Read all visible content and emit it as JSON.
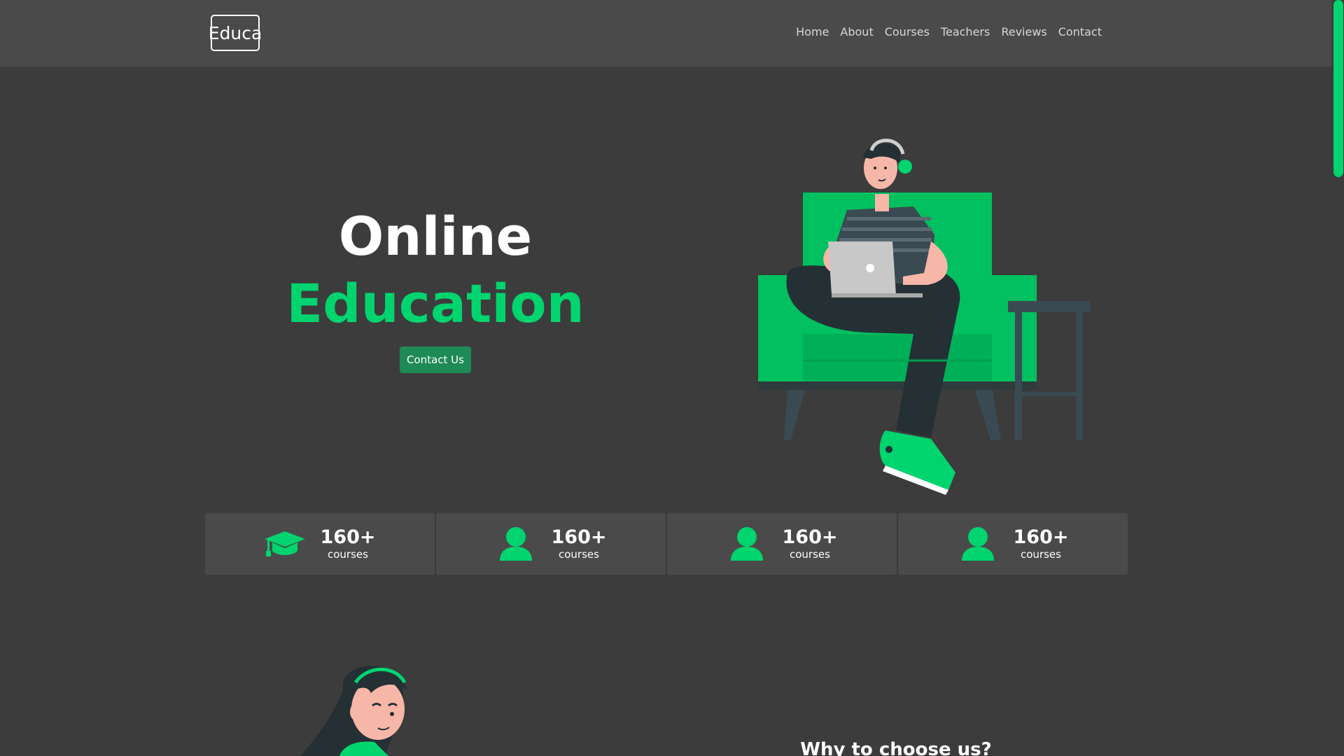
{
  "header": {
    "logo": "Educa",
    "nav": [
      "Home",
      "About",
      "Courses",
      "Teachers",
      "Reviews",
      "Contact"
    ]
  },
  "hero": {
    "line1": "Online",
    "line2": "Education",
    "cta_label": "Contact Us"
  },
  "stats": [
    {
      "icon": "graduation-cap-icon",
      "value": "160+",
      "label": "courses"
    },
    {
      "icon": "user-icon",
      "value": "160+",
      "label": "courses"
    },
    {
      "icon": "user-icon",
      "value": "160+",
      "label": "courses"
    },
    {
      "icon": "user-icon",
      "value": "160+",
      "label": "courses"
    }
  ],
  "section": {
    "title": "Why to choose us?"
  },
  "colors": {
    "accent": "#00d46e",
    "button": "#1e8a55",
    "background": "#3c3c3c",
    "header": "#4a4a4a"
  }
}
